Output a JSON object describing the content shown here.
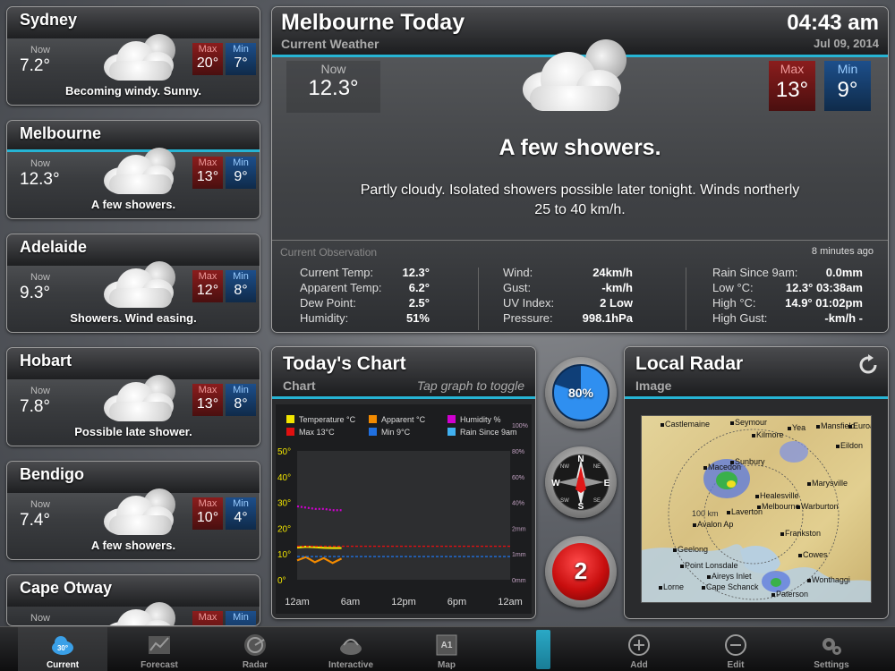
{
  "cities": [
    {
      "name": "Sydney",
      "now_label": "Now",
      "now": "7.2°",
      "max_label": "Max",
      "max": "20°",
      "min_label": "Min",
      "min": "7°",
      "condition": "Becoming windy. Sunny."
    },
    {
      "name": "Melbourne",
      "now_label": "Now",
      "now": "12.3°",
      "max_label": "Max",
      "max": "13°",
      "min_label": "Min",
      "min": "9°",
      "condition": "A few showers."
    },
    {
      "name": "Adelaide",
      "now_label": "Now",
      "now": "9.3°",
      "max_label": "Max",
      "max": "12°",
      "min_label": "Min",
      "min": "8°",
      "condition": "Showers. Wind easing."
    },
    {
      "name": "Hobart",
      "now_label": "Now",
      "now": "7.8°",
      "max_label": "Max",
      "max": "13°",
      "min_label": "Min",
      "min": "8°",
      "condition": "Possible late shower."
    },
    {
      "name": "Bendigo",
      "now_label": "Now",
      "now": "7.4°",
      "max_label": "Max",
      "max": "10°",
      "min_label": "Min",
      "min": "4°",
      "condition": "A few showers."
    },
    {
      "name": "Cape Otway",
      "now_label": "Now",
      "now": "",
      "max_label": "Max",
      "max": "",
      "min_label": "Min",
      "min": "",
      "condition": ""
    }
  ],
  "main": {
    "title": "Melbourne Today",
    "subtitle": "Current Weather",
    "time": "04:43 am",
    "date": "Jul 09, 2014",
    "now_label": "Now",
    "now": "12.3°",
    "max_label": "Max",
    "max": "13°",
    "min_label": "Min",
    "min": "9°",
    "headline": "A few showers.",
    "description": "Partly cloudy. Isolated showers possible later tonight. Winds northerly 25 to 40 km/h."
  },
  "observation": {
    "title": "Current Observation",
    "updated": "8 minutes ago",
    "col1": [
      {
        "k": "Current Temp:",
        "v": "12.3°"
      },
      {
        "k": "Apparent Temp:",
        "v": "6.2°"
      },
      {
        "k": "Dew Point:",
        "v": "2.5°"
      },
      {
        "k": "Humidity:",
        "v": "51%"
      }
    ],
    "col2": [
      {
        "k": "Wind:",
        "v": "24km/h"
      },
      {
        "k": "Gust:",
        "v": "-km/h"
      },
      {
        "k": "UV Index:",
        "v": "2 Low"
      },
      {
        "k": "Pressure:",
        "v": "998.1hPa"
      }
    ],
    "col3": [
      {
        "k": "Rain Since 9am:",
        "v": "0.0mm"
      },
      {
        "k": "Low °C:",
        "v": "12.3° 03:38am"
      },
      {
        "k": "High °C:",
        "v": "14.9° 01:02pm"
      },
      {
        "k": "High Gust:",
        "v": "-km/h -"
      }
    ]
  },
  "chart_panel": {
    "title": "Today's Chart",
    "subtitle": "Chart",
    "hint": "Tap graph to toggle"
  },
  "chart_data": {
    "type": "line",
    "legend": [
      {
        "name": "Temperature °C",
        "color": "#f2e600"
      },
      {
        "name": "Apparent °C",
        "color": "#f28a00"
      },
      {
        "name": "Humidity %",
        "color": "#d000d0"
      },
      {
        "name": "Max 13°C",
        "color": "#e01010"
      },
      {
        "name": "Min 9°C",
        "color": "#2070e0"
      },
      {
        "name": "Rain Since 9am",
        "color": "#40b0f0"
      }
    ],
    "x_ticks": [
      "12am",
      "6am",
      "12pm",
      "6pm",
      "12am"
    ],
    "y_left_ticks": [
      "0°",
      "10°",
      "20°",
      "30°",
      "40°",
      "50°"
    ],
    "y_left_lim": [
      0,
      50
    ],
    "y_right_ticks": [
      "0mm",
      "1mm",
      "2mm",
      "40%",
      "60%",
      "80%",
      "100%"
    ],
    "x_lim_hours": [
      0,
      24
    ],
    "series": [
      {
        "name": "Temperature °C",
        "x": [
          0,
          1,
          2,
          3,
          4,
          5
        ],
        "y": [
          12.5,
          12.8,
          12.6,
          12.4,
          12.3,
          12.3
        ]
      },
      {
        "name": "Apparent °C",
        "x": [
          0,
          1,
          2,
          3,
          4,
          5
        ],
        "y": [
          7.5,
          8.8,
          6.8,
          8.4,
          6.5,
          8.2
        ]
      },
      {
        "name": "Humidity %",
        "x": [
          0,
          1,
          2,
          3,
          4,
          5
        ],
        "y": [
          51,
          50,
          49,
          49,
          48,
          48
        ]
      },
      {
        "name": "Max 13°C",
        "y_const": 13
      },
      {
        "name": "Min 9°C",
        "y_const": 9
      }
    ]
  },
  "widgets": {
    "humidity_gauge": "80%",
    "humidity_fraction": 0.8,
    "compass": {
      "n": "N",
      "e": "E",
      "s": "S",
      "w": "W",
      "ne": "NE",
      "nw": "NW",
      "se": "SE",
      "sw": "SW"
    },
    "alerts_count": "2"
  },
  "radar": {
    "title": "Local Radar",
    "subtitle": "Image",
    "places": [
      "Castlemaine",
      "Seymour",
      "Mansfield",
      "Healesville",
      "Marysville",
      "Eildon",
      "Macedon",
      "Melbourne",
      "Avalon Ap",
      "Geelong",
      "Laverton",
      "Frankston",
      "Point Lonsdale",
      "Cape Schanck",
      "Aireys Inlet",
      "Cowes",
      "Wonthaggi",
      "Paterson",
      "Lorne",
      "Sunbury",
      "Kilmore",
      "Warburton",
      "Yea",
      "Euroa"
    ],
    "range_label": "100 km"
  },
  "tabs": [
    {
      "label": "Current",
      "icon": "cloud-30-icon"
    },
    {
      "label": "Forecast",
      "icon": "trend-chart-icon"
    },
    {
      "label": "Radar",
      "icon": "radar-icon"
    },
    {
      "label": "Interactive",
      "icon": "satellite-dish-icon"
    },
    {
      "label": "Map",
      "icon": "map-a1-icon"
    },
    {
      "label": "Add",
      "icon": "plus-circle-icon"
    },
    {
      "label": "Edit",
      "icon": "minus-circle-icon"
    },
    {
      "label": "Settings",
      "icon": "gears-icon"
    }
  ],
  "tab_badge": "30°",
  "colors": {
    "accent": "#26b4d4",
    "max_red": "#8b1d1d",
    "min_blue": "#1d4f8b",
    "alert_red": "#c80e0e",
    "gauge_blue": "#1f7ad8"
  }
}
